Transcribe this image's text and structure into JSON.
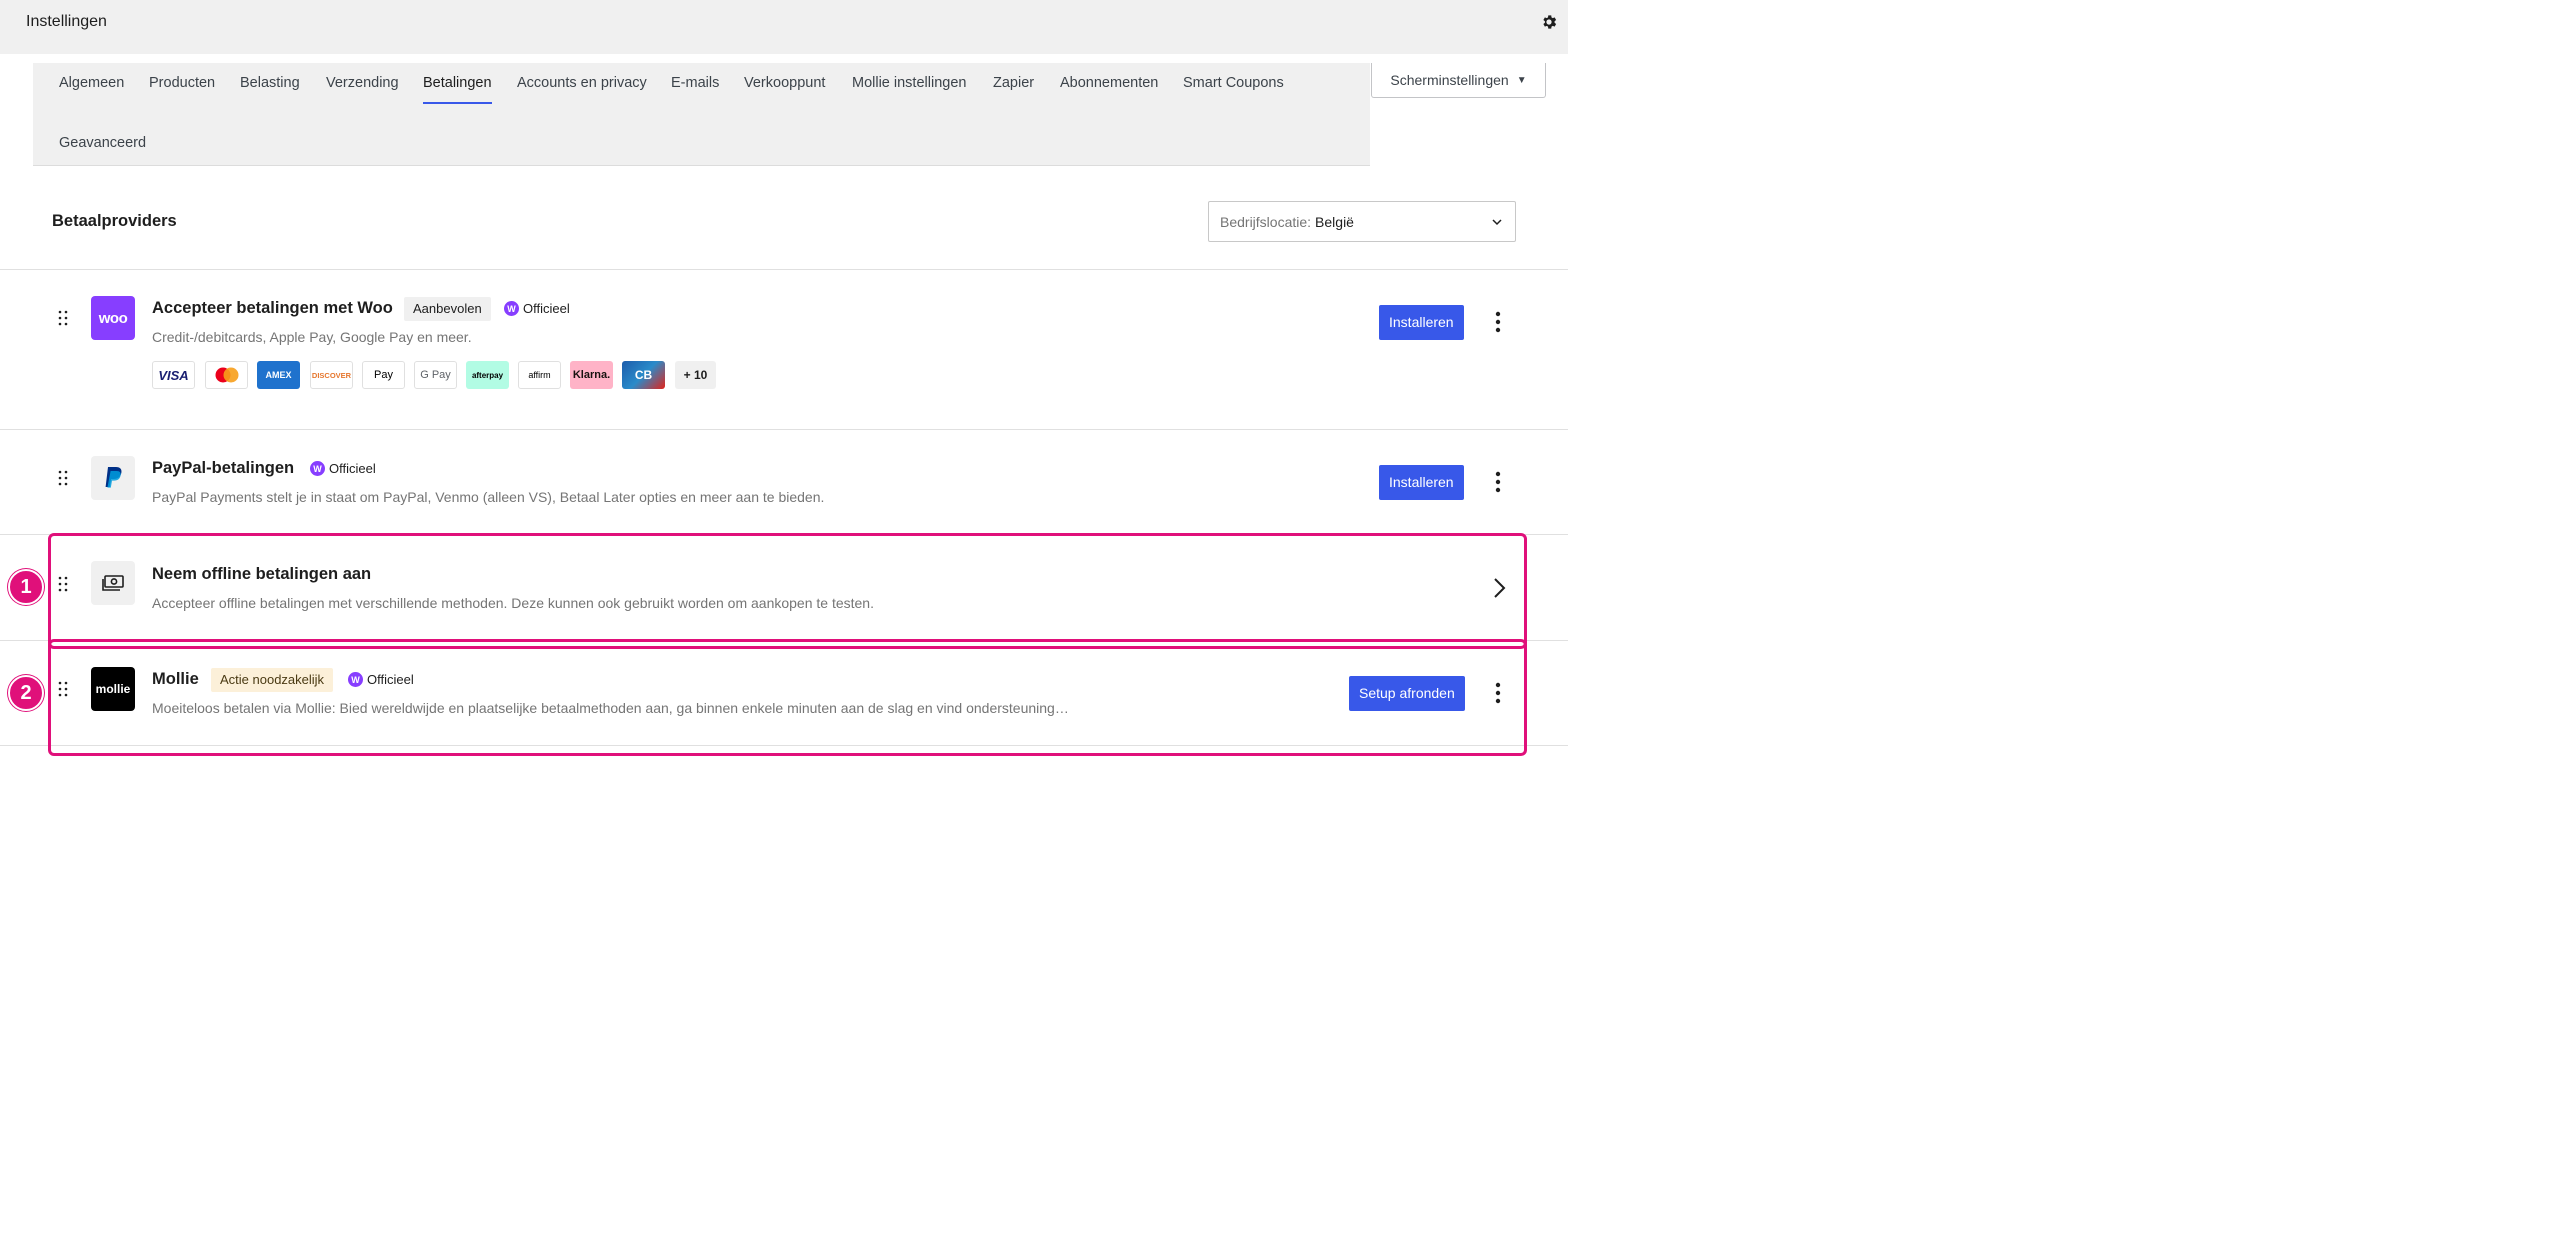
{
  "header": {
    "title": "Instellingen",
    "settings_icon": "gear-icon"
  },
  "tabs": [
    {
      "label": "Algemeen",
      "active": false
    },
    {
      "label": "Producten",
      "active": false
    },
    {
      "label": "Belasting",
      "active": false
    },
    {
      "label": "Verzending",
      "active": false
    },
    {
      "label": "Betalingen",
      "active": true
    },
    {
      "label": "Accounts en privacy",
      "active": false
    },
    {
      "label": "E-mails",
      "active": false
    },
    {
      "label": "Verkooppunt",
      "active": false
    },
    {
      "label": "Mollie instellingen",
      "active": false
    },
    {
      "label": "Zapier",
      "active": false
    },
    {
      "label": "Abonnementen",
      "active": false
    },
    {
      "label": "Smart Coupons",
      "active": false
    },
    {
      "label": "Geavanceerd",
      "active": false
    }
  ],
  "screen_options": {
    "label": "Scherminstellingen"
  },
  "section": {
    "title": "Betaalproviders"
  },
  "location": {
    "label": "Bedrijfslocatie:",
    "value": "België"
  },
  "providers": [
    {
      "name": "Accepteer betalingen met Woo",
      "badge": "Aanbevolen",
      "official": "Officieel",
      "description": "Credit-/debitcards, Apple Pay, Google Pay en meer.",
      "button": "Installeren",
      "logo_text": "woo",
      "payment_methods": [
        "VISA",
        "Mastercard",
        "AMEX",
        "DISCOVER",
        "Pay",
        "G Pay",
        "afterpay",
        "affirm",
        "Klarna.",
        "CB"
      ],
      "more": "+ 10"
    },
    {
      "name": "PayPal-betalingen",
      "official": "Officieel",
      "description": "PayPal Payments stelt je in staat om PayPal, Venmo (alleen VS), Betaal Later opties en meer aan te bieden.",
      "button": "Installeren"
    },
    {
      "name": "Neem offline betalingen aan",
      "description": "Accepteer offline betalingen met verschillende methoden. Deze kunnen ook gebruikt worden om aankopen te testen."
    },
    {
      "name": "Mollie",
      "badge": "Actie noodzakelijk",
      "official": "Officieel",
      "description": "Moeiteloos betalen via Mollie: Bied wereldwijde en plaatselijke betaalmethoden aan, ga binnen enkele minuten aan de slag en vind ondersteuning…",
      "button": "Setup afronden",
      "logo_text": "mollie"
    }
  ],
  "annotations": {
    "marker_1": "1",
    "marker_2": "2"
  },
  "colors": {
    "accent": "#3858e9",
    "highlight": "#e0107a",
    "woo_purple": "#873eff"
  }
}
